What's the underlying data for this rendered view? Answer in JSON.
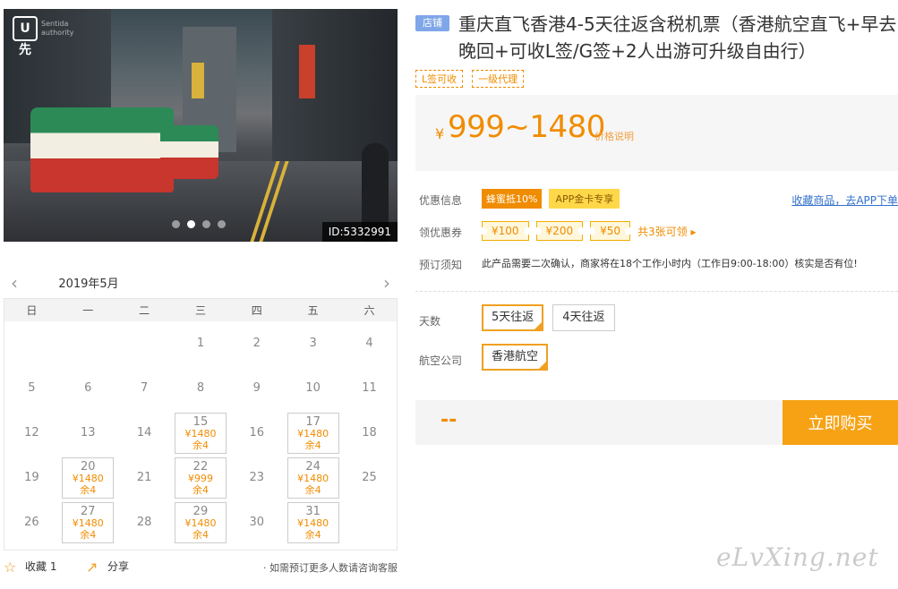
{
  "hero": {
    "logo": "U先",
    "logo_sub": "Sentida\nauthority",
    "image_id": "ID:5332991",
    "slide_count": 4,
    "active_slide": 1
  },
  "calendar": {
    "month": "2019年5月",
    "prev_icon": "chevron-left-icon",
    "next_icon": "chevron-right-icon",
    "weekdays": [
      "日",
      "一",
      "二",
      "三",
      "四",
      "五",
      "六"
    ],
    "weeks": [
      [
        null,
        null,
        null,
        {
          "d": "1"
        },
        {
          "d": "2"
        },
        {
          "d": "3"
        },
        {
          "d": "4"
        }
      ],
      [
        {
          "d": "5"
        },
        {
          "d": "6"
        },
        {
          "d": "7"
        },
        {
          "d": "8"
        },
        {
          "d": "9"
        },
        {
          "d": "10"
        },
        {
          "d": "11"
        }
      ],
      [
        {
          "d": "12"
        },
        {
          "d": "13"
        },
        {
          "d": "14"
        },
        {
          "d": "15",
          "p": "¥1480",
          "s": "余4"
        },
        {
          "d": "16"
        },
        {
          "d": "17",
          "p": "¥1480",
          "s": "余4"
        },
        {
          "d": "18"
        }
      ],
      [
        {
          "d": "19"
        },
        {
          "d": "20",
          "p": "¥1480",
          "s": "余4"
        },
        {
          "d": "21"
        },
        {
          "d": "22",
          "p": "¥999",
          "s": "余4"
        },
        {
          "d": "23"
        },
        {
          "d": "24",
          "p": "¥1480",
          "s": "余4"
        },
        {
          "d": "25"
        }
      ],
      [
        {
          "d": "26"
        },
        {
          "d": "27",
          "p": "¥1480",
          "s": "余4"
        },
        {
          "d": "28"
        },
        {
          "d": "29",
          "p": "¥1480",
          "s": "余4"
        },
        {
          "d": "30"
        },
        {
          "d": "31",
          "p": "¥1480",
          "s": "余4"
        },
        null
      ]
    ]
  },
  "footer_left": {
    "fav_label": "收藏 1",
    "share_label": "分享",
    "note": "· 如需预订更多人数请咨询客服"
  },
  "product": {
    "shop_tag": "店铺",
    "title": "重庆直飞香港4-5天往返含税机票（香港航空直飞+早去晚回+可收L签/G签+2人出游可升级自由行）",
    "tags": [
      "L签可收",
      "一级代理"
    ],
    "price_yen": "¥",
    "price_range": "999~1480",
    "price_note": "价格说明"
  },
  "info": {
    "promo_label": "优惠信息",
    "promo_badges": [
      "蜂蜜抵10%",
      "APP金卡专享"
    ],
    "fav_link": "收藏商品，去APP下单",
    "coupon_label": "领优惠券",
    "coupons": [
      "¥100",
      "¥200",
      "¥50"
    ],
    "coupon_more": "共3张可领 ▸",
    "notice_label": "预订须知",
    "notice_text": "此产品需要二次确认，商家将在18个工作小时内（工作日9:00-18:00）核实是否有位!"
  },
  "options": {
    "days_label": "天数",
    "days": [
      "5天往返",
      "4天往返"
    ],
    "days_selected": 0,
    "airline_label": "航空公司",
    "airlines": [
      "香港航空"
    ],
    "airline_selected": 0
  },
  "buy": {
    "placeholder": "--",
    "button": "立即购买"
  },
  "watermark": "eLvXing.net",
  "colors": {
    "accent": "#f08c00",
    "buy_button": "#f7a214",
    "link": "#3370cc",
    "shop_tag": "#7fa6e8"
  }
}
